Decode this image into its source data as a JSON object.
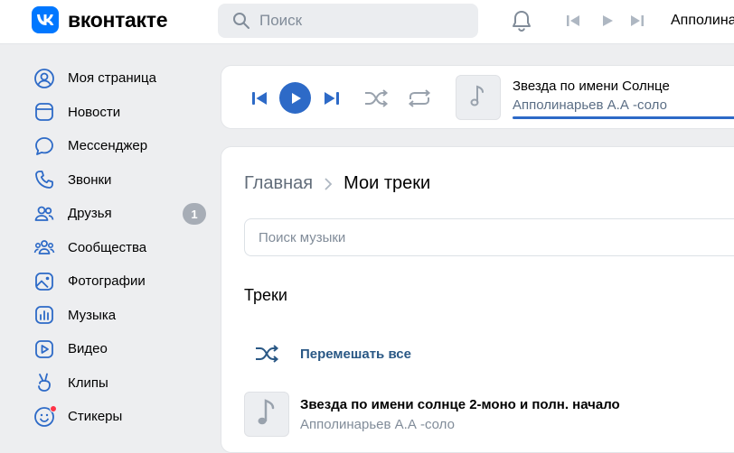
{
  "header": {
    "logo_text": "вконтакте",
    "search_placeholder": "Поиск",
    "user_name": "Апполинарьев"
  },
  "sidebar": {
    "items": [
      {
        "label": "Моя страница",
        "icon": "user-circle-icon"
      },
      {
        "label": "Новости",
        "icon": "newsfeed-icon"
      },
      {
        "label": "Мессенджер",
        "icon": "message-icon"
      },
      {
        "label": "Звонки",
        "icon": "phone-icon"
      },
      {
        "label": "Друзья",
        "icon": "friends-icon",
        "badge": "1"
      },
      {
        "label": "Сообщества",
        "icon": "communities-icon"
      },
      {
        "label": "Фотографии",
        "icon": "photo-icon"
      },
      {
        "label": "Музыка",
        "icon": "music-icon"
      },
      {
        "label": "Видео",
        "icon": "video-icon"
      },
      {
        "label": "Клипы",
        "icon": "clips-icon"
      },
      {
        "label": "Стикеры",
        "icon": "stickers-icon"
      }
    ]
  },
  "player": {
    "track_title": "Звезда по имени Солнце",
    "track_artist": "Апполинарьев А.А -соло"
  },
  "main": {
    "breadcrumb_home": "Главная",
    "breadcrumb_current": "Мои треки",
    "music_search_placeholder": "Поиск музыки",
    "section_title": "Треки",
    "shuffle_label": "Перемешать все",
    "tracks": [
      {
        "title": "Звезда по имени солнце 2-моно и полн. начало",
        "artist": "Апполинарьев А.А -соло"
      }
    ]
  },
  "colors": {
    "accent": "#2d6ac7",
    "brand": "#0077ff",
    "link": "#2a5885",
    "background": "#edeef0"
  }
}
